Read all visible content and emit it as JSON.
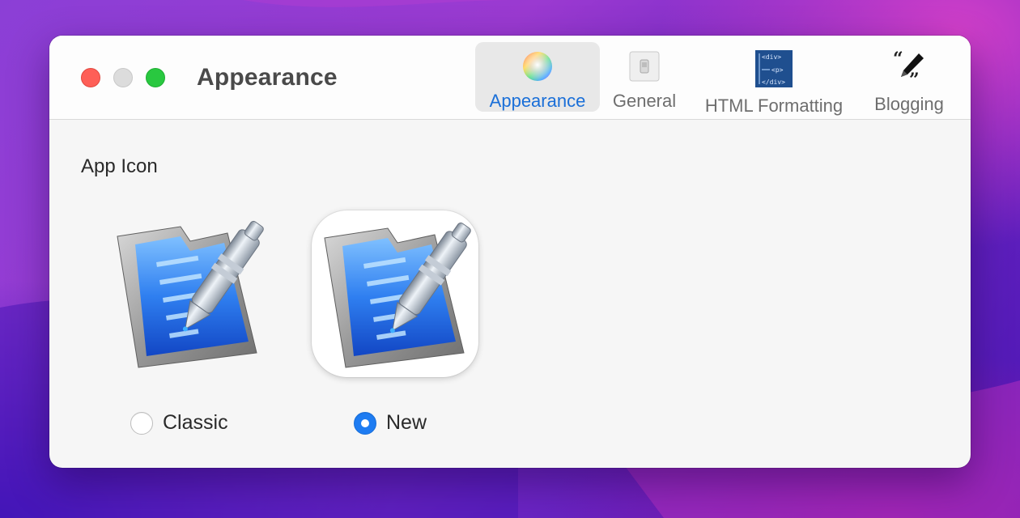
{
  "window": {
    "title": "Appearance"
  },
  "toolbar": {
    "tabs": [
      {
        "label": "Appearance",
        "icon": "color-wheel-icon",
        "selected": true
      },
      {
        "label": "General",
        "icon": "switch-icon",
        "selected": false
      },
      {
        "label": "HTML Formatting",
        "icon": "html-code-icon",
        "selected": false
      },
      {
        "label": "Blogging",
        "icon": "quote-pen-icon",
        "selected": false
      }
    ],
    "html_icon_lines": [
      "<div>",
      "<p>",
      "</div>"
    ]
  },
  "content": {
    "section_heading": "App Icon",
    "options": [
      {
        "label": "Classic",
        "selected": false
      },
      {
        "label": "New",
        "selected": true
      }
    ]
  },
  "colors": {
    "accent": "#1a6fd8",
    "close": "#fe5f57",
    "minimize": "#dcdcdc",
    "zoom": "#29c840"
  }
}
